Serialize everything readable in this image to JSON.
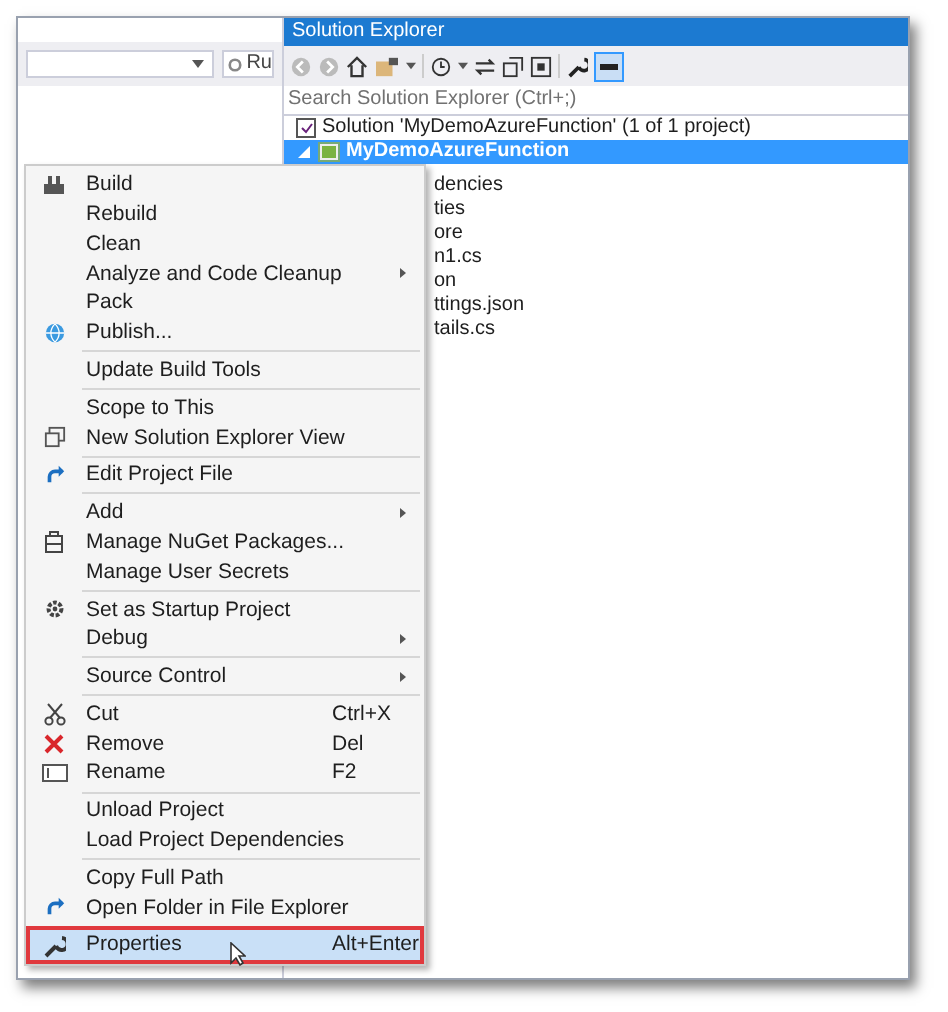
{
  "left_toolbar": {
    "combo_text": "Ru"
  },
  "solution_explorer": {
    "title": "Solution Explorer",
    "search": {
      "placeholder": "Search Solution Explorer (Ctrl+;)"
    },
    "tree": [
      {
        "label": "Solution 'MyDemoAzureFunction' (1 of 1 project)",
        "selected": false,
        "children": [
          {
            "label": "MyDemoAzureFunction",
            "selected": true,
            "expanded": true,
            "children": [
              {
                "label": "dencies",
                "selected": false
              },
              {
                "label": "ties",
                "selected": false
              },
              {
                "label": "ore",
                "selected": false
              },
              {
                "label": "n1.cs",
                "selected": false
              },
              {
                "label": "on",
                "selected": false
              },
              {
                "label": "ttings.json",
                "selected": false
              },
              {
                "label": "tails.cs",
                "selected": false
              }
            ]
          }
        ]
      }
    ]
  },
  "context_menu": [
    {
      "kind": "item",
      "label": "Build",
      "selected": false
    },
    {
      "kind": "item",
      "label": "Rebuild",
      "selected": false
    },
    {
      "kind": "item",
      "label": "Clean",
      "selected": false
    },
    {
      "kind": "item",
      "label": "Analyze and Code Cleanup",
      "submenu": true,
      "selected": false
    },
    {
      "kind": "item",
      "label": "Pack",
      "selected": false
    },
    {
      "kind": "item",
      "label": "Publish...",
      "selected": false
    },
    {
      "kind": "separator"
    },
    {
      "kind": "item",
      "label": "Update Build Tools",
      "selected": false
    },
    {
      "kind": "separator"
    },
    {
      "kind": "item",
      "label": "Scope to This",
      "selected": false
    },
    {
      "kind": "item",
      "label": "New Solution Explorer View",
      "selected": false
    },
    {
      "kind": "separator"
    },
    {
      "kind": "item",
      "label": "Edit Project File",
      "selected": false
    },
    {
      "kind": "separator"
    },
    {
      "kind": "item",
      "label": "Add",
      "submenu": true,
      "selected": false
    },
    {
      "kind": "item",
      "label": "Manage NuGet Packages...",
      "selected": false
    },
    {
      "kind": "item",
      "label": "Manage User Secrets",
      "selected": false
    },
    {
      "kind": "separator"
    },
    {
      "kind": "item",
      "label": "Set as Startup Project",
      "selected": false
    },
    {
      "kind": "item",
      "label": "Debug",
      "submenu": true,
      "selected": false
    },
    {
      "kind": "separator"
    },
    {
      "kind": "item",
      "label": "Source Control",
      "submenu": true,
      "selected": false
    },
    {
      "kind": "separator"
    },
    {
      "kind": "item",
      "label": "Cut",
      "shortcut": "Ctrl+X",
      "selected": false
    },
    {
      "kind": "item",
      "label": "Remove",
      "shortcut": "Del",
      "selected": false
    },
    {
      "kind": "item",
      "label": "Rename",
      "shortcut": "F2",
      "selected": false
    },
    {
      "kind": "separator"
    },
    {
      "kind": "item",
      "label": "Unload Project",
      "selected": false
    },
    {
      "kind": "item",
      "label": "Load Project Dependencies",
      "selected": false
    },
    {
      "kind": "separator"
    },
    {
      "kind": "item",
      "label": "Copy Full Path",
      "selected": false
    },
    {
      "kind": "item",
      "label": "Open Folder in File Explorer",
      "selected": false
    },
    {
      "kind": "separator"
    },
    {
      "kind": "item",
      "label": "Properties",
      "shortcut": "Alt+Enter",
      "selected": true
    }
  ]
}
